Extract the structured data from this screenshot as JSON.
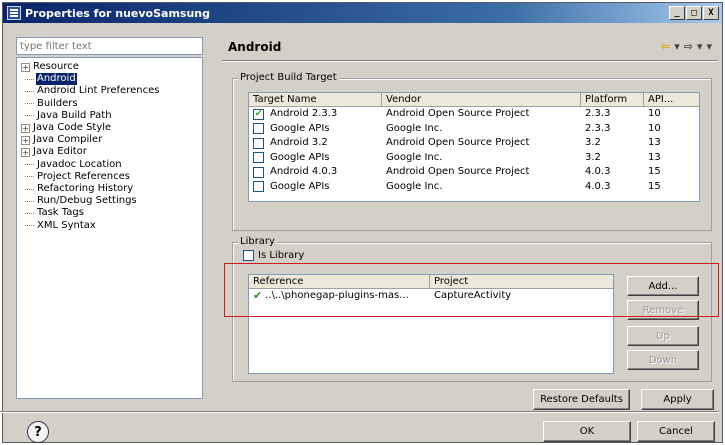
{
  "window": {
    "title": "Properties for nuevoSamsung",
    "btn_min": "_",
    "btn_max": "□",
    "btn_close": "X"
  },
  "filter": {
    "placeholder": "type filter text"
  },
  "nav": {
    "items": [
      {
        "label": "Resource",
        "expander": "+"
      },
      {
        "label": "Android",
        "selected": true
      },
      {
        "label": "Android Lint Preferences"
      },
      {
        "label": "Builders"
      },
      {
        "label": "Java Build Path"
      },
      {
        "label": "Java Code Style",
        "expander": "+"
      },
      {
        "label": "Java Compiler",
        "expander": "+"
      },
      {
        "label": "Java Editor",
        "expander": "+"
      },
      {
        "label": "Javadoc Location"
      },
      {
        "label": "Project References"
      },
      {
        "label": "Refactoring History"
      },
      {
        "label": "Run/Debug Settings"
      },
      {
        "label": "Task Tags"
      },
      {
        "label": "XML Syntax"
      }
    ]
  },
  "header": {
    "title": "Android",
    "arrows": "⇦ ▾ ⇨ ▾ ▾"
  },
  "build_target": {
    "group_title": "Project Build Target",
    "columns": [
      "Target Name",
      "Vendor",
      "Platform",
      "API..."
    ],
    "rows": [
      {
        "name": "Android 2.3.3",
        "vendor": "Android Open Source Project",
        "platform": "2.3.3",
        "api": "10",
        "checked": true
      },
      {
        "name": "Google APIs",
        "vendor": "Google Inc.",
        "platform": "2.3.3",
        "api": "10",
        "checked": false
      },
      {
        "name": "Android 3.2",
        "vendor": "Android Open Source Project",
        "platform": "3.2",
        "api": "13",
        "checked": false
      },
      {
        "name": "Google APIs",
        "vendor": "Google Inc.",
        "platform": "3.2",
        "api": "13",
        "checked": false
      },
      {
        "name": "Android 4.0.3",
        "vendor": "Android Open Source Project",
        "platform": "4.0.3",
        "api": "15",
        "checked": false
      },
      {
        "name": "Google APIs",
        "vendor": "Google Inc.",
        "platform": "4.0.3",
        "api": "15",
        "checked": false
      }
    ]
  },
  "library": {
    "group_title": "Library",
    "is_library_label": "Is Library",
    "columns": [
      "Reference",
      "Project"
    ],
    "rows": [
      {
        "reference": "..\\..\\phonegap-plugins-mas...",
        "project": "CaptureActivity"
      }
    ],
    "buttons": {
      "add": "Add...",
      "remove": "Remove",
      "up": "Up",
      "down": "Down"
    }
  },
  "actions": {
    "restore": "Restore Defaults",
    "apply": "Apply"
  },
  "footer": {
    "help": "?",
    "ok": "OK",
    "cancel": "Cancel"
  },
  "colors": {
    "highlight": "#cc1c1c",
    "selection": "#0a246a"
  }
}
